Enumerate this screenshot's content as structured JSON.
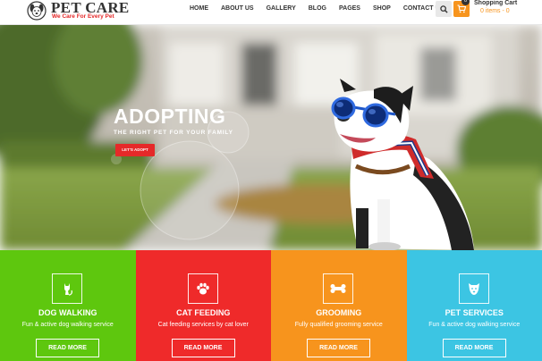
{
  "brand": {
    "name": "PET CARE",
    "tagline": "We Care For Every Pet"
  },
  "nav": [
    {
      "label": "HOME"
    },
    {
      "label": "ABOUT US"
    },
    {
      "label": "GALLERY"
    },
    {
      "label": "BLOG"
    },
    {
      "label": "PAGES"
    },
    {
      "label": "SHOP"
    },
    {
      "label": "CONTACT US"
    }
  ],
  "cart": {
    "badge": "0",
    "title": "Shopping Cart",
    "items": "0 items - 0"
  },
  "hero": {
    "title": "ADOPTING",
    "subtitle": "THE RIGHT PET FOR YOUR FAMILY",
    "button": "LET'S ADOPT"
  },
  "services": [
    {
      "icon": "cat-icon",
      "title": "DOG WALKING",
      "desc": "Fun & active dog walking service",
      "button": "READ MORE",
      "color": "#5ec70e"
    },
    {
      "icon": "paw-icon",
      "title": "CAT FEEDING",
      "desc": "Cat feeding services by cat lover",
      "button": "READ MORE",
      "color": "#ef2a2a"
    },
    {
      "icon": "bone-icon",
      "title": "GROOMING",
      "desc": "Fully qualified grooming service",
      "button": "READ MORE",
      "color": "#f7941d"
    },
    {
      "icon": "dog-face-icon",
      "title": "PET SERVICES",
      "desc": "Fun & active dog walking service",
      "button": "READ MORE",
      "color": "#3cc5e3"
    }
  ]
}
